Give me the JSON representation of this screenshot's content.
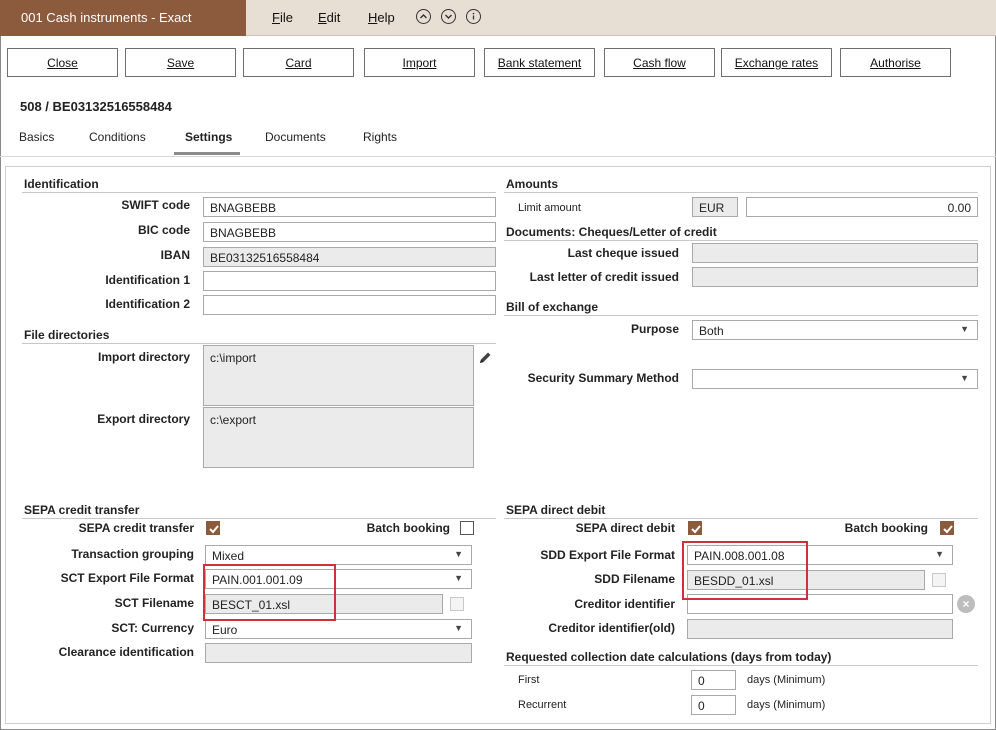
{
  "titlebar": {
    "app_title": "001 Cash instruments - Exact",
    "menu": [
      {
        "key": "F",
        "rest": "ile"
      },
      {
        "key": "E",
        "rest": "dit"
      },
      {
        "key": "H",
        "rest": "elp"
      }
    ],
    "icons": [
      "chevron-up-circle-icon",
      "chevron-down-circle-icon",
      "info-circle-icon"
    ]
  },
  "toolbar": {
    "close": "Close",
    "save": "Save",
    "card": "Card",
    "import": "Import",
    "bank_statement": "Bank statement",
    "cash_flow": "Cash flow",
    "exchange_rates": "Exchange rates",
    "authorise": "Authorise"
  },
  "record_title": "508 / BE03132516558484",
  "tabs": [
    "Basics",
    "Conditions",
    "Settings",
    "Documents",
    "Rights"
  ],
  "active_tab": "Settings",
  "identification": {
    "heading": "Identification",
    "swift_label": "SWIFT code",
    "swift_value": "BNAGBEBB",
    "bic_label": "BIC code",
    "bic_value": "BNAGBEBB",
    "iban_label": "IBAN",
    "iban_value": "BE03132516558484",
    "id1_label": "Identification 1",
    "id1_value": "",
    "id2_label": "Identification 2",
    "id2_value": ""
  },
  "file_directories": {
    "heading": "File directories",
    "import_label": "Import directory",
    "import_value": "c:\\import",
    "export_label": "Export directory",
    "export_value": "c:\\export"
  },
  "amounts": {
    "heading": "Amounts",
    "limit_label": "Limit amount",
    "currency": "EUR",
    "limit_value": "0.00"
  },
  "documents": {
    "heading": "Documents: Cheques/Letter of credit",
    "last_cheque_label": "Last cheque issued",
    "last_cheque_value": "",
    "last_loc_label": "Last letter of credit issued",
    "last_loc_value": ""
  },
  "bill_of_exchange": {
    "heading": "Bill of exchange",
    "purpose_label": "Purpose",
    "purpose_value": "Both",
    "security_label": "Security Summary Method",
    "security_value": ""
  },
  "sepa_credit": {
    "heading": "SEPA credit transfer",
    "sct_label": "SEPA credit transfer",
    "sct_checked": true,
    "batch_label": "Batch booking",
    "batch_checked": false,
    "grouping_label": "Transaction grouping",
    "grouping_value": "Mixed",
    "format_label": "SCT Export File Format",
    "format_value": "PAIN.001.001.09",
    "filename_label": "SCT Filename",
    "filename_value": "BESCT_01.xsl",
    "currency_label": "SCT: Currency",
    "currency_value": "Euro",
    "clearance_label": "Clearance identification",
    "clearance_value": ""
  },
  "sepa_debit": {
    "heading": "SEPA direct debit",
    "sdd_label": "SEPA direct debit",
    "sdd_checked": true,
    "batch_label": "Batch booking",
    "batch_checked": true,
    "format_label": "SDD Export File Format",
    "format_value": "PAIN.008.001.08",
    "filename_label": "SDD Filename",
    "filename_value": "BESDD_01.xsl",
    "creditor_label": "Creditor identifier",
    "creditor_value": "",
    "creditor_old_label": "Creditor identifier(old)",
    "creditor_old_value": ""
  },
  "collection": {
    "heading": "Requested collection date calculations (days from today)",
    "first_label": "First",
    "first_value": "0",
    "first_unit": "days (Minimum)",
    "recurrent_label": "Recurrent",
    "recurrent_value": "0",
    "recurrent_unit": "days (Minimum)"
  },
  "colors": {
    "brand": "#8c5a3c",
    "titlebar_bg": "#e7ded4",
    "highlight": "#d0303a",
    "readonly_bg": "#ebebeb"
  }
}
